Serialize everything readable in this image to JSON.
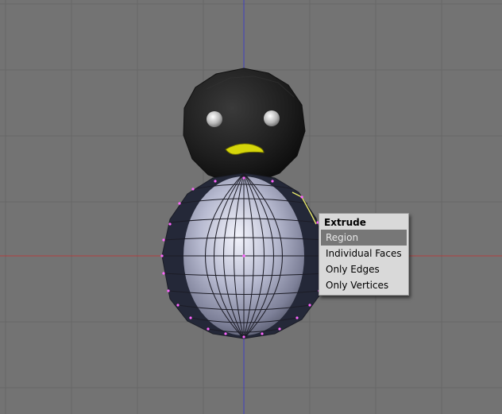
{
  "viewport": {
    "background": "#737373",
    "grid_color": "#676767",
    "axis_x_color": "#b04040",
    "axis_y_color": "#4040c0",
    "selection_color": "#ff66ff",
    "object_names": [
      "penguin-head",
      "penguin-body"
    ]
  },
  "menu": {
    "title": "Extrude",
    "items": [
      {
        "label": "Region",
        "active": true
      },
      {
        "label": "Individual Faces",
        "active": false
      },
      {
        "label": "Only Edges",
        "active": false
      },
      {
        "label": "Only Vertices",
        "active": false
      }
    ]
  }
}
